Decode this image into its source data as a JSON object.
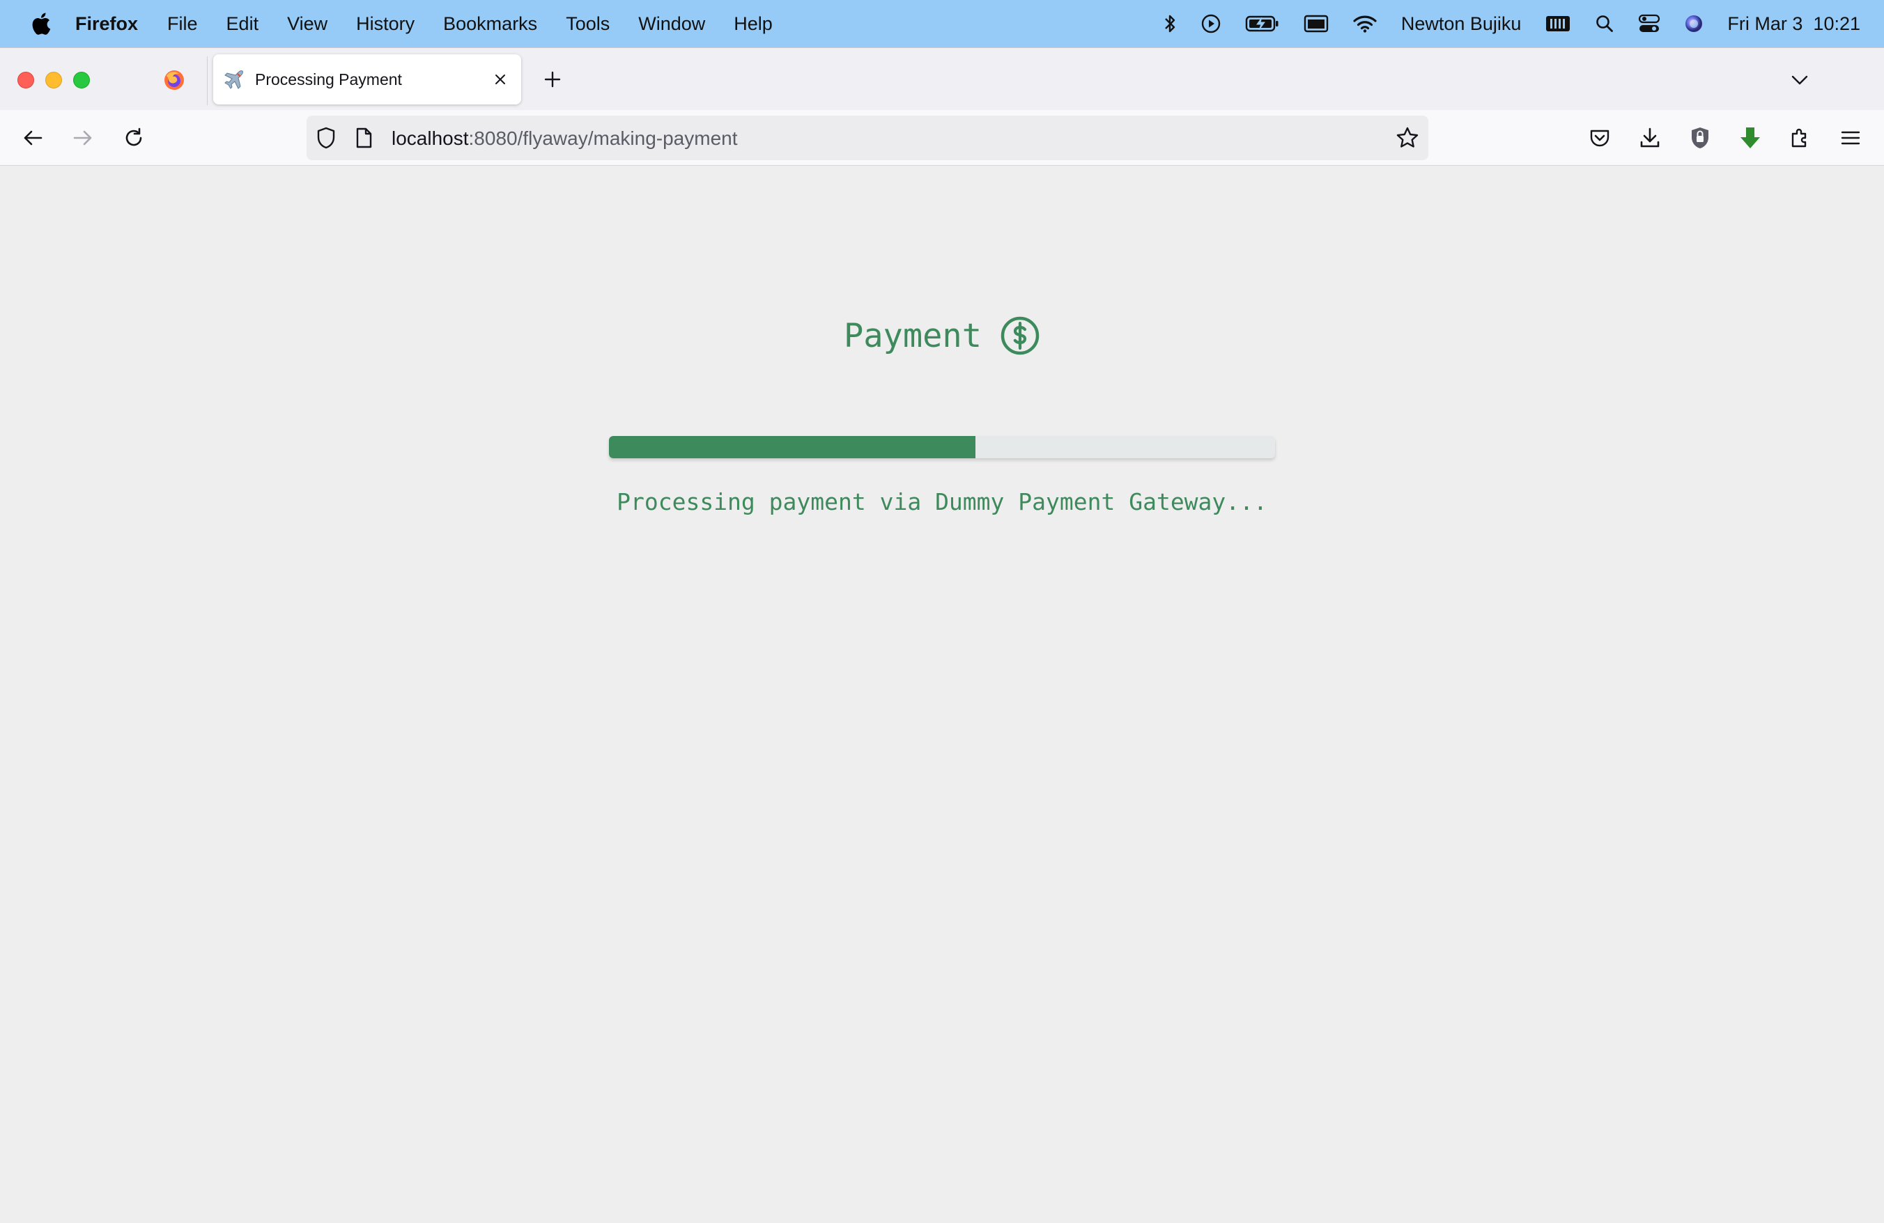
{
  "menubar": {
    "app_name": "Firefox",
    "items": [
      "File",
      "Edit",
      "View",
      "History",
      "Bookmarks",
      "Tools",
      "Window",
      "Help"
    ],
    "user_name": "Newton Bujiku",
    "datetime": "Fri Mar 3  10:21"
  },
  "browser": {
    "tab_title": "Processing Payment",
    "url_host": "localhost",
    "url_rest": ":8080/flyaway/making-payment"
  },
  "page": {
    "heading": "Payment",
    "progress_percent": 55,
    "status_text": "Processing payment via Dummy Payment Gateway..."
  },
  "colors": {
    "accent_green": "#3d8a5c",
    "menubar_bg": "#96cbf7"
  }
}
